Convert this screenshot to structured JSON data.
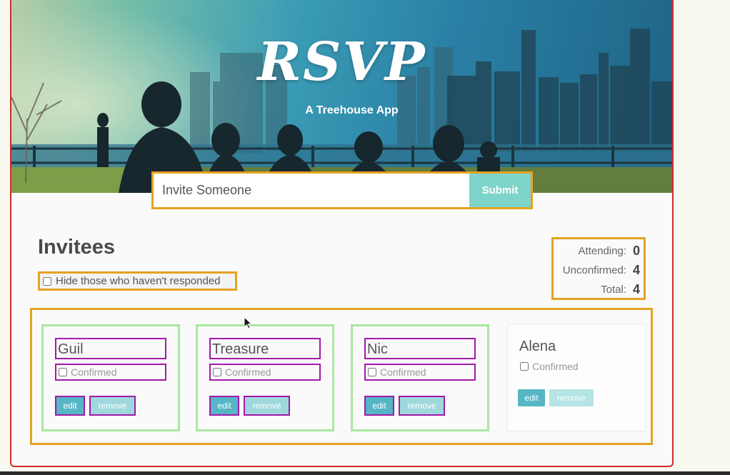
{
  "header": {
    "title": "RSVP",
    "subtitle": "A Treehouse App"
  },
  "form": {
    "placeholder": "Invite Someone",
    "submit_label": "Submit"
  },
  "invitees": {
    "heading": "Invitees",
    "hide_filter_label": "Hide those who haven't responded"
  },
  "counter": {
    "attending_label": "Attending:",
    "attending": "0",
    "unconfirmed_label": "Unconfirmed:",
    "unconfirmed": "4",
    "total_label": "Total:",
    "total": "4"
  },
  "cards": [
    {
      "name": "Guil",
      "confirm_label": "Confirmed",
      "edit_label": "edit",
      "remove_label": "remove"
    },
    {
      "name": "Treasure",
      "confirm_label": "Confirmed",
      "edit_label": "edit",
      "remove_label": "remove"
    },
    {
      "name": "Nic",
      "confirm_label": "Confirmed",
      "edit_label": "edit",
      "remove_label": "remove"
    },
    {
      "name": "Alena",
      "confirm_label": "Confirmed",
      "edit_label": "edit",
      "remove_label": "remove"
    }
  ],
  "colors": {
    "frame_border": "#d22a2a",
    "highlight_orange": "#e6a222",
    "highlight_green": "#a8e8a0",
    "highlight_purple": "#a21aa8",
    "submit_bg": "#7fd4c9",
    "edit_bg": "#56b6c6",
    "remove_bg": "#9ed8dd"
  }
}
